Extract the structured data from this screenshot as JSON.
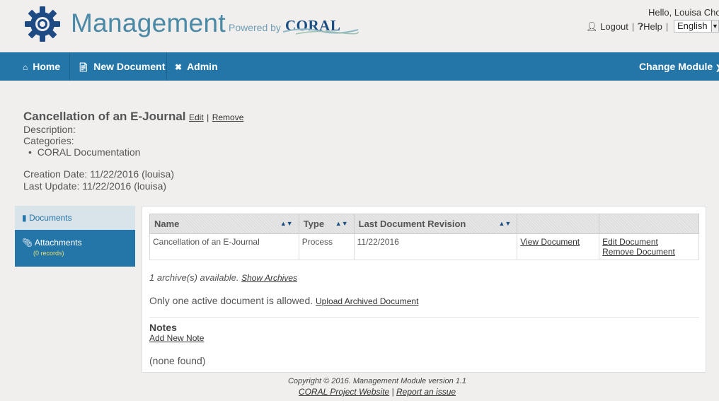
{
  "header": {
    "app_title": "Management",
    "powered_by": "Powered by",
    "brand": "CORAL",
    "greeting": "Hello, Louisa Cho",
    "logout": "Logout",
    "help": "Help",
    "language": "English"
  },
  "nav": {
    "home": "Home",
    "new_document": "New Document",
    "admin": "Admin",
    "change_module": "Change Module"
  },
  "document": {
    "title": "Cancellation of an E-Journal",
    "edit": "Edit",
    "remove": "Remove",
    "description_label": "Description:",
    "categories_label": "Categories:",
    "category": "CORAL Documentation",
    "creation_date": "Creation Date: 11/22/2016 (louisa)",
    "last_update": "Last Update: 11/22/2016 (louisa)"
  },
  "sidebar": {
    "documents": "Documents",
    "attachments": "Attachments",
    "attachments_count": "(0 records)"
  },
  "table": {
    "headers": [
      "Name",
      "Type",
      "Last Document Revision",
      "",
      ""
    ],
    "rows": [
      {
        "name": "Cancellation of an E-Journal",
        "type": "Process",
        "revision": "11/22/2016",
        "view": "View Document",
        "edit": "Edit Document",
        "remove": "Remove Document"
      }
    ]
  },
  "archives": {
    "text": "1 archive(s) available.",
    "link": "Show Archives"
  },
  "active": {
    "text": "Only one active document is allowed.",
    "link": "Upload Archived Document"
  },
  "notes": {
    "heading": "Notes",
    "add": "Add New Note",
    "empty": "(none found)"
  },
  "footer": {
    "copyright": "Copyright © 2016. Management Module version 1.1",
    "project_link": "CORAL Project Website",
    "report_link": "Report an issue"
  },
  "colors": {
    "accent": "#2576a8",
    "title": "#4a8aa6",
    "brand": "#1b4f83"
  }
}
